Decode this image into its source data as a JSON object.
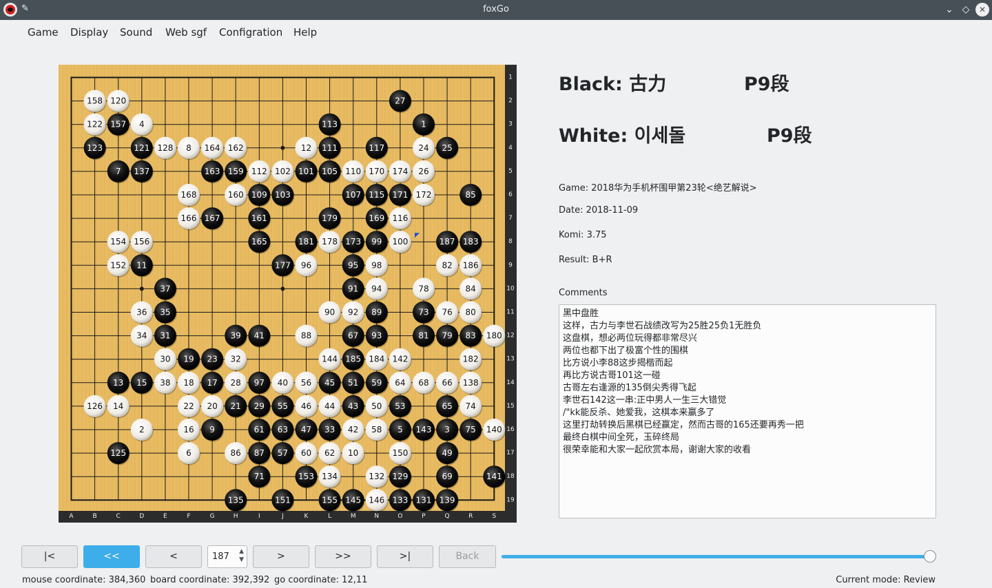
{
  "window": {
    "title": "foxGo"
  },
  "menu": [
    "Game",
    "Display",
    "Sound",
    "Web sgf",
    "Configration",
    "Help"
  ],
  "info": {
    "black_label": "Black: 古力",
    "black_rank": "P9段",
    "white_label": "White: 이세돌",
    "white_rank": "P9段",
    "game": "Game: 2018华为手机杯围甲第23轮<绝艺解说>",
    "date": "Date: 2018-11-09",
    "komi": "Komi: 3.75",
    "result": "Result: B+R",
    "comments_label": "Comments"
  },
  "comments": [
    "黑中盘胜",
    "这样，古力与李世石战绩改写为25胜25负1无胜负",
    "这盘棋，想必两位玩得都非常尽兴",
    "两位也都下出了极富个性的围棋",
    "比方说小李88这步揭楷而起",
    "再比方说古哥101这一碰",
    "古哥左右逢源的135倒尖秀得飞起",
    "李世石142这一串:正中男人一生三大错觉",
    "/\"kk能反杀、她爱我，这棋本来赢多了",
    "这里打劫转换后黑棋已经赢定，然而古哥的165还要再秀一把",
    "最终白棋中间全死，玉碎终局",
    "很荣幸能和大家一起欣赏本局，谢谢大家的收看"
  ],
  "nav": {
    "first": "|<",
    "prev_fast": "<<",
    "prev": "<",
    "move_number": "187",
    "next": ">",
    "next_fast": ">>",
    "last": ">|",
    "back": "Back"
  },
  "progress": 1.0,
  "status": {
    "mouse": "mouse coordinate: 384,360",
    "board": "board coordinate: 392,392",
    "go": "go coordinate: 12,11",
    "mode": "Current mode: Review"
  },
  "board": {
    "size": 19,
    "col_labels": [
      "A",
      "B",
      "C",
      "D",
      "E",
      "F",
      "G",
      "H",
      "I",
      "J",
      "K",
      "L",
      "M",
      "N",
      "O",
      "P",
      "Q",
      "R",
      "S"
    ],
    "row_labels": [
      "1",
      "2",
      "3",
      "4",
      "5",
      "6",
      "7",
      "8",
      "9",
      "10",
      "11",
      "12",
      "13",
      "14",
      "15",
      "16",
      "17",
      "18",
      "19"
    ],
    "last_move": [
      16,
      8
    ],
    "stones": [
      [
        "w",
        2,
        2,
        158
      ],
      [
        "w",
        3,
        2,
        120
      ],
      [
        "b",
        15,
        2,
        27
      ],
      [
        "w",
        2,
        3,
        122
      ],
      [
        "b",
        3,
        3,
        157
      ],
      [
        "w",
        4,
        3,
        4
      ],
      [
        "b",
        12,
        3,
        113
      ],
      [
        "b",
        16,
        3,
        1
      ],
      [
        "b",
        2,
        4,
        123
      ],
      [
        "b",
        4,
        4,
        121
      ],
      [
        "w",
        5,
        4,
        128
      ],
      [
        "w",
        6,
        4,
        8
      ],
      [
        "w",
        7,
        4,
        164
      ],
      [
        "w",
        8,
        4,
        162
      ],
      [
        "w",
        11,
        4,
        12
      ],
      [
        "b",
        12,
        4,
        111
      ],
      [
        "b",
        14,
        4,
        117
      ],
      [
        "w",
        16,
        4,
        24
      ],
      [
        "b",
        17,
        4,
        25
      ],
      [
        "b",
        3,
        5,
        7
      ],
      [
        "b",
        4,
        5,
        137
      ],
      [
        "b",
        7,
        5,
        163
      ],
      [
        "b",
        8,
        5,
        159
      ],
      [
        "w",
        9,
        5,
        112
      ],
      [
        "w",
        10,
        5,
        102
      ],
      [
        "b",
        11,
        5,
        101
      ],
      [
        "b",
        12,
        5,
        105
      ],
      [
        "w",
        13,
        5,
        110
      ],
      [
        "w",
        14,
        5,
        170
      ],
      [
        "w",
        15,
        5,
        174
      ],
      [
        "w",
        16,
        5,
        26
      ],
      [
        "w",
        6,
        6,
        168
      ],
      [
        "w",
        8,
        6,
        160
      ],
      [
        "b",
        9,
        6,
        109
      ],
      [
        "b",
        10,
        6,
        103
      ],
      [
        "b",
        13,
        6,
        107
      ],
      [
        "b",
        14,
        6,
        115
      ],
      [
        "b",
        15,
        6,
        171
      ],
      [
        "w",
        16,
        6,
        172
      ],
      [
        "b",
        18,
        6,
        85
      ],
      [
        "w",
        6,
        7,
        166
      ],
      [
        "b",
        7,
        7,
        167
      ],
      [
        "b",
        9,
        7,
        161
      ],
      [
        "b",
        12,
        7,
        179
      ],
      [
        "b",
        14,
        7,
        169
      ],
      [
        "w",
        15,
        7,
        116
      ],
      [
        "w",
        3,
        8,
        154
      ],
      [
        "w",
        4,
        8,
        156
      ],
      [
        "b",
        9,
        8,
        165
      ],
      [
        "b",
        11,
        8,
        181
      ],
      [
        "w",
        12,
        8,
        178
      ],
      [
        "b",
        13,
        8,
        173
      ],
      [
        "b",
        14,
        8,
        99
      ],
      [
        "w",
        15,
        8,
        100
      ],
      [
        "b",
        17,
        8,
        187
      ],
      [
        "b",
        18,
        8,
        183
      ],
      [
        "w",
        3,
        9,
        152
      ],
      [
        "b",
        4,
        9,
        11
      ],
      [
        "b",
        10,
        9,
        177
      ],
      [
        "w",
        11,
        9,
        96
      ],
      [
        "b",
        13,
        9,
        95
      ],
      [
        "w",
        14,
        9,
        98
      ],
      [
        "w",
        17,
        9,
        82
      ],
      [
        "w",
        18,
        9,
        186
      ],
      [
        "b",
        5,
        10,
        37
      ],
      [
        "b",
        13,
        10,
        91
      ],
      [
        "w",
        14,
        10,
        94
      ],
      [
        "w",
        16,
        10,
        78
      ],
      [
        "w",
        18,
        10,
        84
      ],
      [
        "w",
        4,
        11,
        36
      ],
      [
        "b",
        5,
        11,
        35
      ],
      [
        "w",
        12,
        11,
        90
      ],
      [
        "w",
        13,
        11,
        92
      ],
      [
        "b",
        14,
        11,
        89
      ],
      [
        "b",
        16,
        11,
        73
      ],
      [
        "w",
        17,
        11,
        76
      ],
      [
        "w",
        18,
        11,
        80
      ],
      [
        "w",
        4,
        12,
        34
      ],
      [
        "b",
        5,
        12,
        31
      ],
      [
        "b",
        8,
        12,
        39
      ],
      [
        "b",
        9,
        12,
        41
      ],
      [
        "w",
        11,
        12,
        88
      ],
      [
        "b",
        13,
        12,
        67
      ],
      [
        "b",
        14,
        12,
        93
      ],
      [
        "b",
        16,
        12,
        81
      ],
      [
        "b",
        17,
        12,
        79
      ],
      [
        "b",
        18,
        12,
        83
      ],
      [
        "w",
        19,
        12,
        180
      ],
      [
        "w",
        5,
        13,
        30
      ],
      [
        "b",
        6,
        13,
        19
      ],
      [
        "b",
        7,
        13,
        23
      ],
      [
        "w",
        8,
        13,
        32
      ],
      [
        "w",
        12,
        13,
        144
      ],
      [
        "b",
        13,
        13,
        185
      ],
      [
        "w",
        14,
        13,
        184
      ],
      [
        "w",
        15,
        13,
        142
      ],
      [
        "w",
        18,
        13,
        182
      ],
      [
        "b",
        3,
        14,
        13
      ],
      [
        "b",
        4,
        14,
        15
      ],
      [
        "w",
        5,
        14,
        38
      ],
      [
        "w",
        6,
        14,
        18
      ],
      [
        "b",
        7,
        14,
        17
      ],
      [
        "w",
        8,
        14,
        28
      ],
      [
        "b",
        9,
        14,
        97
      ],
      [
        "w",
        10,
        14,
        40
      ],
      [
        "w",
        11,
        14,
        56
      ],
      [
        "b",
        12,
        14,
        45
      ],
      [
        "b",
        13,
        14,
        51
      ],
      [
        "b",
        14,
        14,
        59
      ],
      [
        "w",
        15,
        14,
        64
      ],
      [
        "w",
        16,
        14,
        68
      ],
      [
        "w",
        17,
        14,
        66
      ],
      [
        "w",
        18,
        14,
        138
      ],
      [
        "w",
        2,
        15,
        126
      ],
      [
        "w",
        3,
        15,
        14
      ],
      [
        "w",
        6,
        15,
        22
      ],
      [
        "w",
        7,
        15,
        20
      ],
      [
        "b",
        8,
        15,
        21
      ],
      [
        "b",
        9,
        15,
        29
      ],
      [
        "b",
        10,
        15,
        55
      ],
      [
        "w",
        11,
        15,
        46
      ],
      [
        "w",
        12,
        15,
        44
      ],
      [
        "b",
        13,
        15,
        43
      ],
      [
        "w",
        14,
        15,
        50
      ],
      [
        "b",
        15,
        15,
        53
      ],
      [
        "b",
        17,
        15,
        65
      ],
      [
        "w",
        18,
        15,
        74
      ],
      [
        "w",
        4,
        16,
        2
      ],
      [
        "w",
        6,
        16,
        16
      ],
      [
        "b",
        7,
        16,
        9
      ],
      [
        "b",
        9,
        16,
        61
      ],
      [
        "b",
        10,
        16,
        63
      ],
      [
        "b",
        11,
        16,
        47
      ],
      [
        "b",
        12,
        16,
        33
      ],
      [
        "w",
        13,
        16,
        42
      ],
      [
        "w",
        14,
        16,
        58
      ],
      [
        "b",
        15,
        16,
        5
      ],
      [
        "b",
        16,
        16,
        143
      ],
      [
        "b",
        17,
        16,
        3
      ],
      [
        "b",
        18,
        16,
        75
      ],
      [
        "w",
        19,
        16,
        140
      ],
      [
        "b",
        3,
        17,
        125
      ],
      [
        "w",
        6,
        17,
        6
      ],
      [
        "w",
        8,
        17,
        86
      ],
      [
        "b",
        9,
        17,
        87
      ],
      [
        "b",
        10,
        17,
        57
      ],
      [
        "w",
        11,
        17,
        60
      ],
      [
        "w",
        12,
        17,
        62
      ],
      [
        "w",
        13,
        17,
        10
      ],
      [
        "w",
        15,
        17,
        150
      ],
      [
        "b",
        17,
        17,
        49
      ],
      [
        "b",
        9,
        18,
        71
      ],
      [
        "b",
        11,
        18,
        153
      ],
      [
        "w",
        12,
        18,
        134
      ],
      [
        "w",
        14,
        18,
        132
      ],
      [
        "b",
        15,
        18,
        129
      ],
      [
        "b",
        17,
        18,
        69
      ],
      [
        "b",
        19,
        18,
        141
      ],
      [
        "b",
        8,
        19,
        135
      ],
      [
        "b",
        10,
        19,
        151
      ],
      [
        "b",
        12,
        19,
        155
      ],
      [
        "b",
        13,
        19,
        145
      ],
      [
        "w",
        14,
        19,
        146
      ],
      [
        "b",
        15,
        19,
        133
      ],
      [
        "b",
        16,
        19,
        131
      ],
      [
        "b",
        17,
        19,
        139
      ]
    ]
  }
}
